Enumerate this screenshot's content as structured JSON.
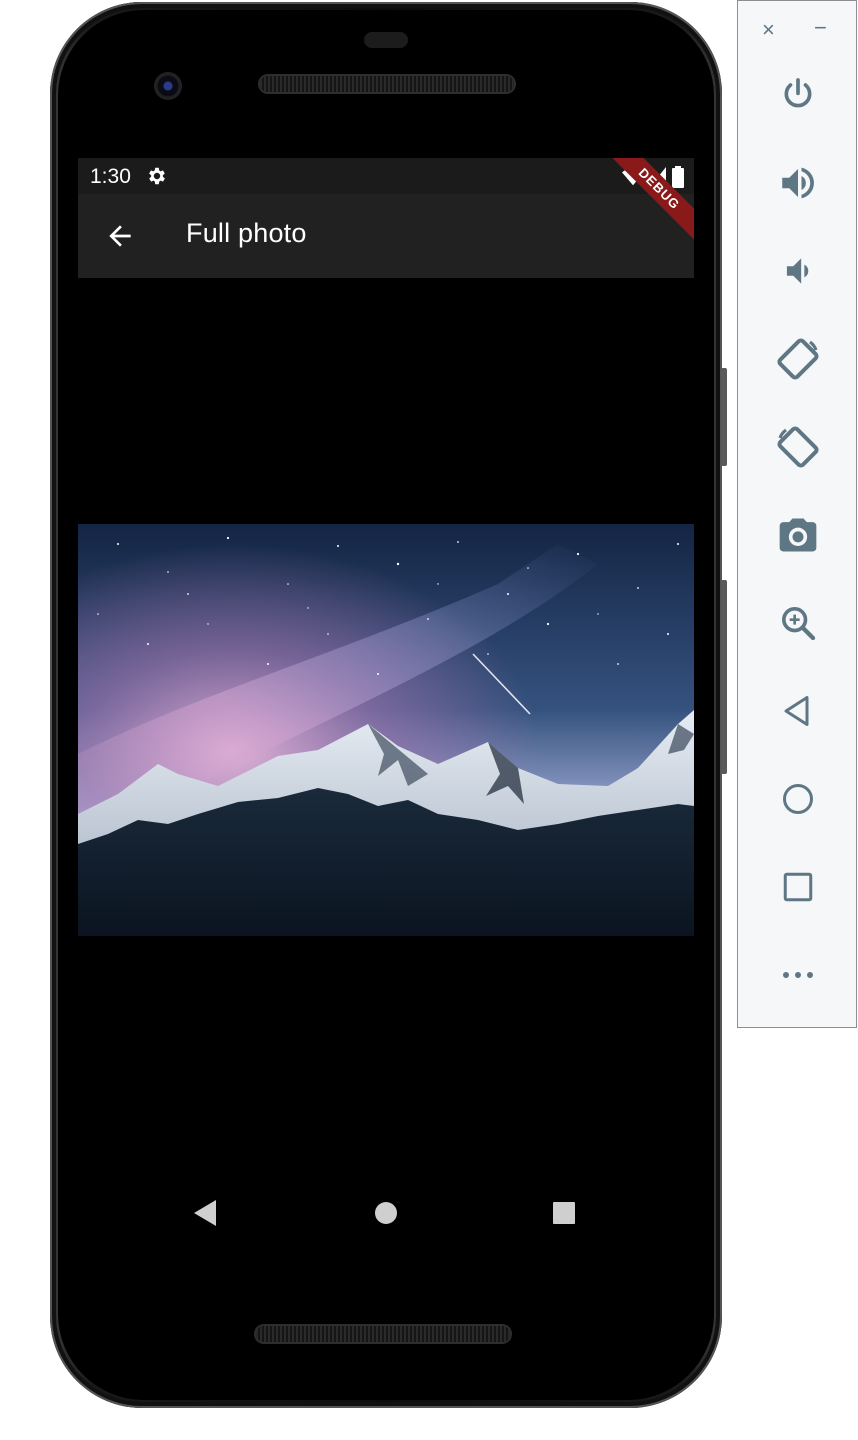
{
  "status_bar": {
    "time": "1:30",
    "icons": [
      "gear-icon",
      "wifi-icon",
      "signal-icon",
      "battery-icon"
    ]
  },
  "app_bar": {
    "title": "Full photo",
    "back_icon": "arrow-back-icon"
  },
  "debug_banner": {
    "label": "DEBUG"
  },
  "photo": {
    "subject": "starry night sky with milky way over snowy mountains",
    "colors": {
      "sky_top": "#1b2a4e",
      "sky_glow": "#b88ab8",
      "mountain": "#c9d2dc",
      "forest": "#0f1a26"
    }
  },
  "nav_bar": {
    "icons": [
      "nav-back-icon",
      "nav-home-icon",
      "nav-recents-icon"
    ]
  },
  "emulator_panel": {
    "window_controls": {
      "close": "×",
      "minimize": "−"
    },
    "tools": [
      {
        "name": "power-icon"
      },
      {
        "name": "volume-up-icon"
      },
      {
        "name": "volume-down-icon"
      },
      {
        "name": "rotate-left-icon"
      },
      {
        "name": "rotate-right-icon"
      },
      {
        "name": "camera-icon"
      },
      {
        "name": "zoom-icon"
      },
      {
        "name": "back-icon"
      },
      {
        "name": "home-icon"
      },
      {
        "name": "overview-icon"
      },
      {
        "name": "more-icon"
      }
    ],
    "colors": {
      "icon": "#5f7785",
      "background": "#f5f7f8",
      "border": "#8a8f92"
    }
  },
  "colors": {
    "status_bar": "#1b1b1b",
    "app_bar": "#212121",
    "screen": "#000000",
    "debug_banner": "#8a1a1a"
  }
}
